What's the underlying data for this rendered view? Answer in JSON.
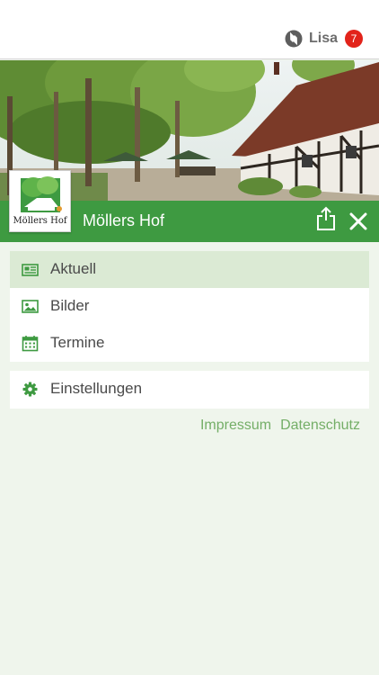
{
  "user": {
    "name": "Lisa",
    "notification_count": "7"
  },
  "header": {
    "title": "Möllers Hof",
    "logo_text": "Möllers Hof"
  },
  "menu": {
    "items": [
      {
        "label": "Aktuell",
        "icon": "newspaper-icon",
        "active": true
      },
      {
        "label": "Bilder",
        "icon": "image-icon",
        "active": false
      },
      {
        "label": "Termine",
        "icon": "calendar-icon",
        "active": false
      }
    ],
    "settings_label": "Einstellungen",
    "settings_icon": "gear-icon"
  },
  "footer": {
    "imprint_label": "Impressum",
    "privacy_label": "Datenschutz"
  },
  "colors": {
    "brand_green": "#3e9a41",
    "active_bg": "#dbead4",
    "link_green": "#74ae67",
    "badge_red": "#e2231a",
    "page_bg": "#eff5ec"
  }
}
